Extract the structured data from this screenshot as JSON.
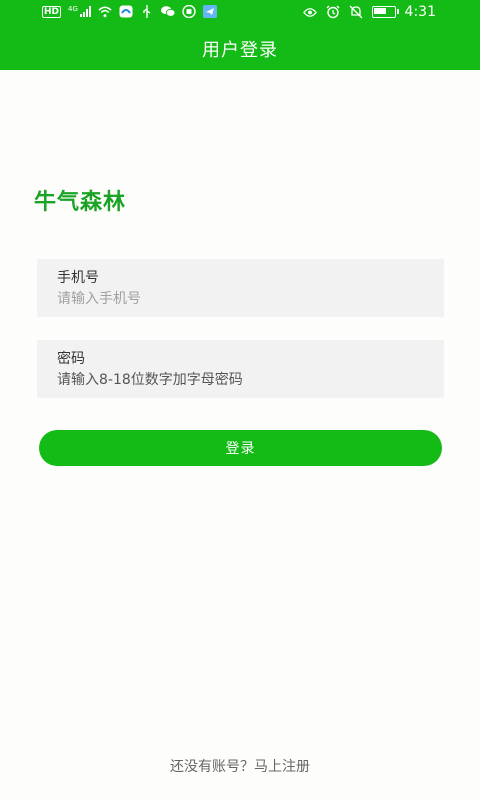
{
  "status_bar": {
    "network_badge": "HD",
    "network_type": "4G",
    "time": "4:31",
    "icons": [
      "hd-icon",
      "signal-icon",
      "wifi-icon",
      "app-notification-icon",
      "usb-icon",
      "wechat-icon",
      "hand-icon",
      "telegram-icon",
      "eye-icon",
      "alarm-icon",
      "mute-icon",
      "battery-icon"
    ],
    "battery_level": 0.7
  },
  "header": {
    "title": "用户登录"
  },
  "brand": {
    "name": "牛气森林"
  },
  "form": {
    "phone": {
      "label": "手机号",
      "placeholder": "请输入手机号"
    },
    "password": {
      "label": "密码",
      "placeholder": "请输入8-18位数字加字母密码"
    },
    "submit_label": "登录"
  },
  "footer": {
    "register_text": "还没有账号？马上注册"
  },
  "colors": {
    "primary": "#14bb17",
    "brand_text": "#1aa324",
    "field_bg": "#f2f2f2"
  }
}
